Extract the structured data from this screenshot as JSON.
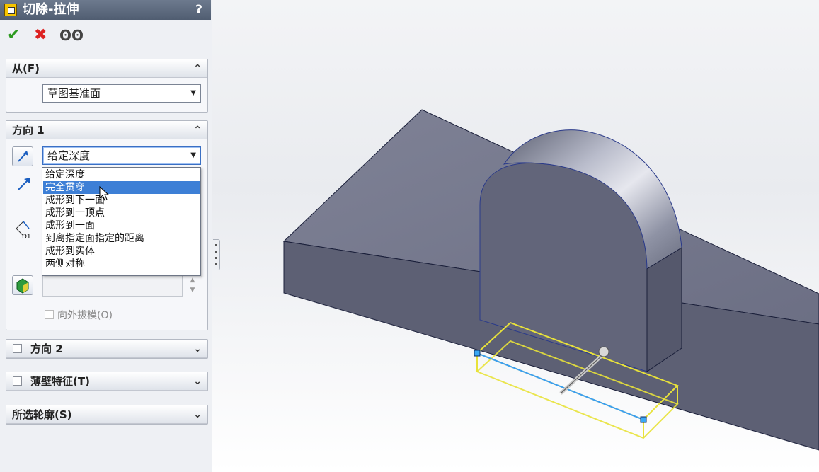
{
  "panel": {
    "title": "切除-拉伸",
    "help": "?",
    "actions": {
      "ok_icon": "checkmark-icon",
      "cancel_icon": "x-icon",
      "preview_icon": "glasses-icon"
    },
    "from": {
      "header": "从(F)",
      "selected": "草图基准面"
    },
    "direction1": {
      "header": "方向 1",
      "end_condition": "给定深度",
      "options": [
        "给定深度",
        "完全贯穿",
        "成形到下一面",
        "成形到一顶点",
        "成形到一面",
        "到离指定面指定的距离",
        "成形到实体",
        "两侧对称"
      ],
      "highlighted_option": "完全贯穿",
      "draft_outward_label": "向外拔模(O)"
    },
    "direction2": {
      "header": "方向 2"
    },
    "thin_feature": {
      "header": "薄壁特征(T)"
    },
    "selected_contours": {
      "header": "所选轮廓(S)"
    }
  },
  "colors": {
    "title_bar": "#505d71",
    "selection_blue": "#3d7fd6",
    "preview_yellow": "#e8e23a",
    "model_face": "#6f7287"
  }
}
